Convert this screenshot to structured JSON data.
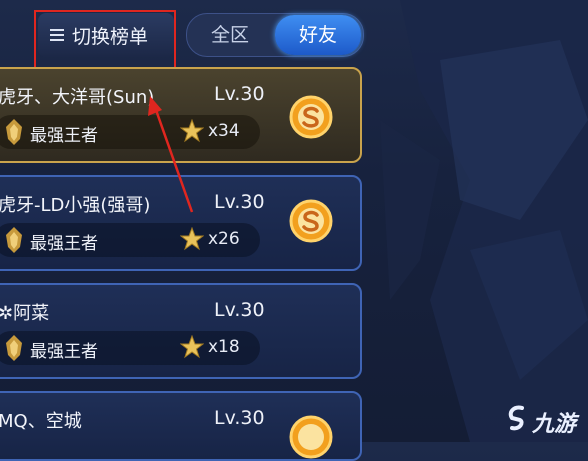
{
  "header": {
    "switch_label": "切换榜单",
    "tabs": [
      {
        "label": "全区",
        "active": false
      },
      {
        "label": "好友",
        "active": true
      }
    ]
  },
  "entries": [
    {
      "name": "虎牙、大洋哥(Sun)",
      "level": "Lv.30",
      "rank": "最强王者",
      "stars": "x34",
      "highlighted": true
    },
    {
      "name": "虎牙-LD小强(强哥)",
      "level": "Lv.30",
      "rank": "最强王者",
      "stars": "x26",
      "highlighted": false
    },
    {
      "name": "✲阿菜",
      "level": "Lv.30",
      "rank": "最强王者",
      "stars": "x18",
      "highlighted": false
    },
    {
      "name": "MQ、空城",
      "level": "Lv.30",
      "rank": "",
      "stars": "",
      "highlighted": false
    }
  ],
  "watermark": {
    "text": "九游"
  },
  "colors": {
    "annotation_red": "#e0261f",
    "card_border_blue": "#3f64b5",
    "card_border_gold": "#c9a34c",
    "tab_active_blue": "#2f7be8"
  }
}
